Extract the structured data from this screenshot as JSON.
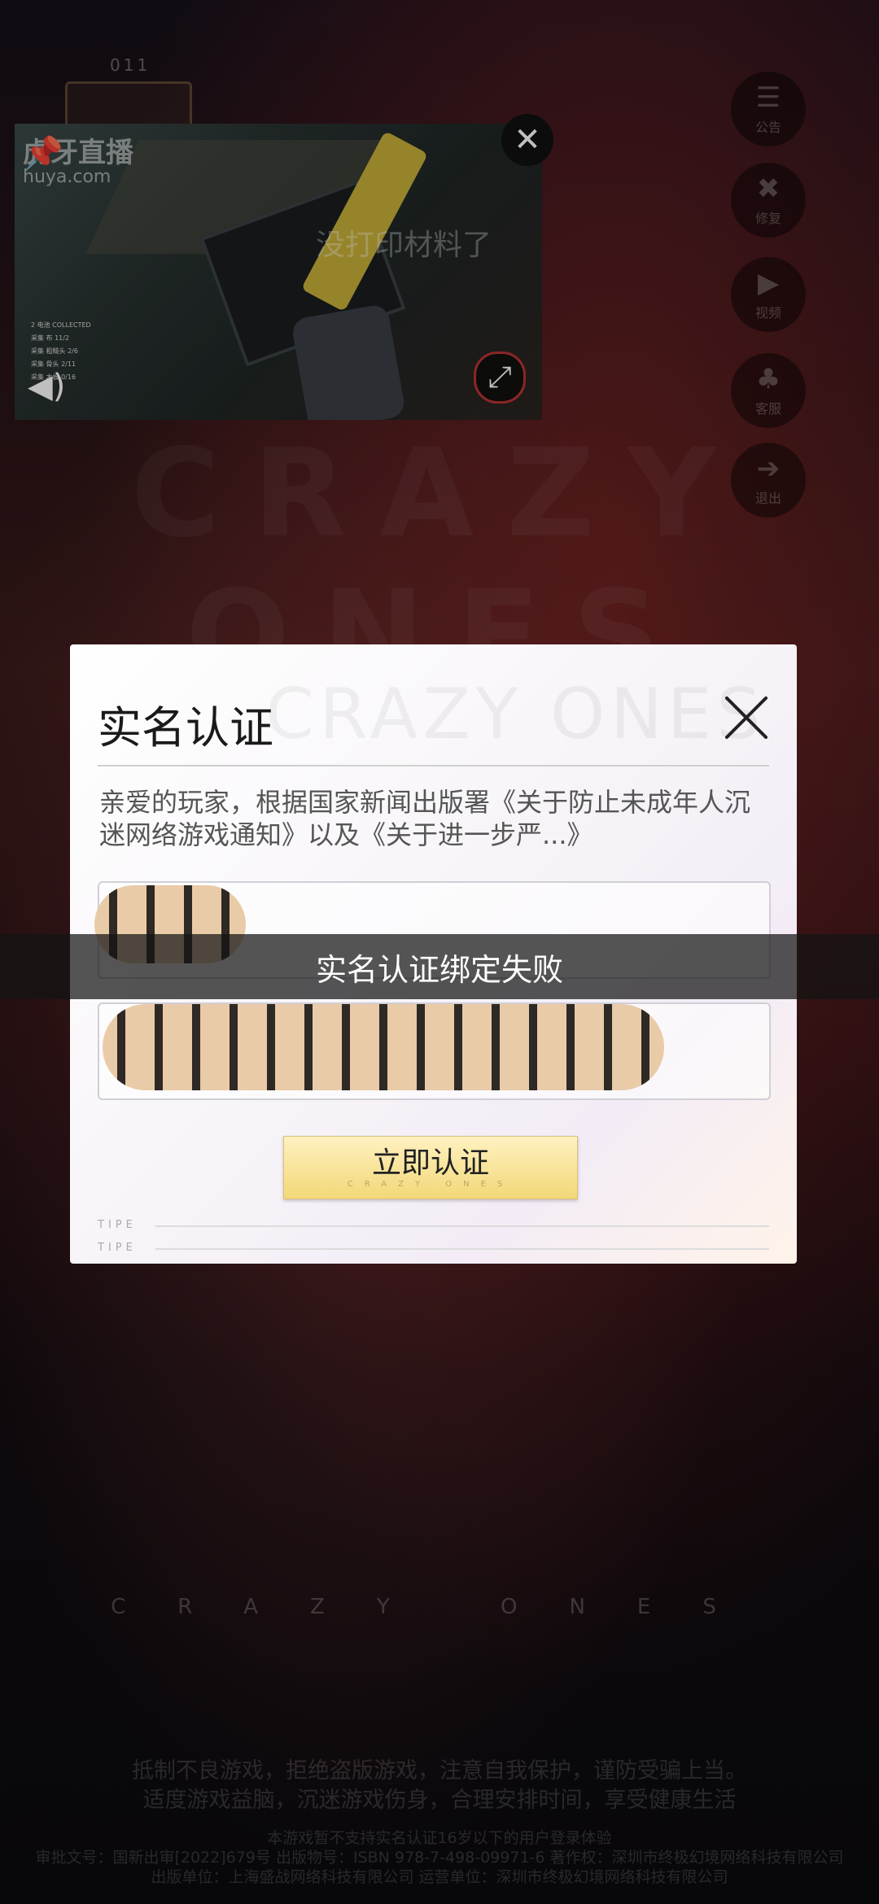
{
  "background": {
    "watermark_text": "CRAZY ONES",
    "top_number": "011"
  },
  "side_menu": [
    {
      "icon": "notice-icon",
      "glyph": "☰",
      "label": "公告"
    },
    {
      "icon": "repair-icon",
      "glyph": "✖",
      "label": "修复"
    },
    {
      "icon": "video-icon",
      "glyph": "▶",
      "label": "视频"
    },
    {
      "icon": "bell-icon",
      "glyph": "♣",
      "label": "客服"
    },
    {
      "icon": "exit-icon",
      "glyph": "➔",
      "label": "退出"
    }
  ],
  "video_window": {
    "brand": "虎牙直播",
    "brand_sub": "huya.com",
    "overlay_text": "没打印材料了",
    "hud_lines": [
      "2 电池 COLLECTED",
      "采集 布 11/2",
      "采集 粗糙头 2/6",
      "采集 骨头 2/11",
      "采集 木板 0/16"
    ]
  },
  "dialog": {
    "watermark": "CRAZY ONES",
    "title": "实名认证",
    "notice": "亲爱的玩家，根据国家新闻出版署《关于防止未成年人沉迷网络游戏通知》以及《关于进一步严...》",
    "name_field": {
      "value": ""
    },
    "id_field": {
      "value": ""
    },
    "submit_label": "立即认证",
    "submit_sub": "CRAZY ONES",
    "tipe_1": "TIPE",
    "tipe_2": "TIPE"
  },
  "toast": "实名认证绑定失败",
  "footer": {
    "brand_spaced": "CRAZY ONES",
    "health_1": "抵制不良游戏，拒绝盗版游戏，注意自我保护，谨防受骗上当。",
    "health_2": "适度游戏益脑，沉迷游戏伤身，合理安排时间，享受健康生活",
    "legal_1": "本游戏暂不支持实名认证16岁以下的用户登录体验",
    "legal_2": "审批文号：国新出审[2022]679号  出版物号：ISBN 978-7-498-09971-6  著作权：深圳市终极幻境网络科技有限公司",
    "legal_3": "出版单位：上海盛战网络科技有限公司  运营单位：深圳市终极幻境网络科技有限公司"
  }
}
